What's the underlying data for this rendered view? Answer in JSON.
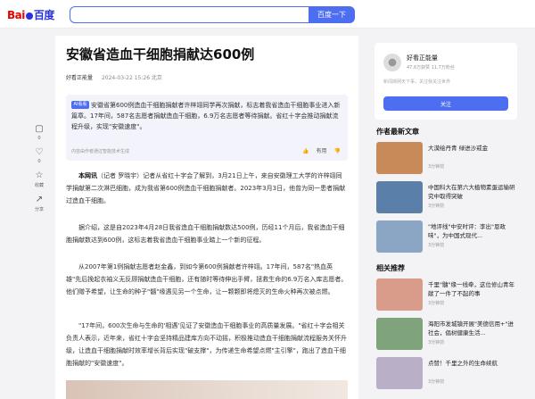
{
  "header": {
    "logo_text_bai": "Bai",
    "logo_text_du": "百度",
    "search_value": "",
    "search_button": "百度一下"
  },
  "article": {
    "title": "安徽省造血干细胞捐献达600例",
    "author": "好看正能量",
    "datetime": "2024-03-22 15:26 北京",
    "ai_tag": "AI看看",
    "ai_summary": "安徽省第600例造血干细胞捐献者许梓翊同学再次捐献，标志着我省造血干细胞事业进入新篇章。17年间，587名志愿者捐献造血干细胞，6.9万名志愿者等待捐献。省红十字会推动捐献流程升级，实现\"安徽速度\"。",
    "ai_footer": "内容由作者通过智能技术生成",
    "ai_useful": "有用",
    "paragraphs": [
      {
        "lead": "本网讯",
        "text": "（记者 罗晓宇）记者从省红十字会了解到，3月21日上午，来自安徽理工大学的许梓翊同学捐献第二次淋巴细胞，成为我省第600例造血干细胞捐献者。2023年3月3日，他曾为同一患者捐献过造血干细胞。"
      },
      {
        "lead": "",
        "text": "据介绍，这是自2023年4月28日我省造血干细胞捐献数达500例，历经11个月后，我省造血干细胞捐献数达到600例，这标志着我省造血干细胞事业踏上一个新的征程。"
      },
      {
        "lead": "",
        "text": "从2007年第1例捐献志愿者赵金鑫，到如今第600例捐献者许梓翊。17年间，587名\"热血英雄\"先后挽起衣袖义无反顾捐献造血干细胞，还有随时等待伸出手臂，拯救生命的6.9万名入库志愿者。他们赠予希望，让生命的种子\"髓\"缘遇见另一个生命，让一颗颗即将熄灭的生命火种再次被点燃。"
      },
      {
        "lead": "",
        "text": "\"17年间，600次生命与生命的'相遇'见证了安徽造血干细胞事业的高质量发展。\"省红十字会相关负责人表示，近年来，省红十字会坚持精品建库方向不动摇，积极推动造血干细胞捐献流程服务关怀升级，让造血干细胞捐献时效率增长背后实现\"破支撑\"，为传递生命希望点燃\"主引擎\"，跑出了造血干细胞捐献的\"安徽速度\"。"
      }
    ]
  },
  "float_actions": [
    {
      "icon": "comment-icon",
      "label": "0"
    },
    {
      "icon": "like-icon",
      "label": "0"
    },
    {
      "icon": "star-icon",
      "label": "收藏"
    },
    {
      "icon": "share-icon",
      "label": "分享"
    }
  ],
  "author_card": {
    "name": "好看正能量",
    "stats": "47.6万获赞 11.7万粉丝",
    "desc": "新闻撷网天下事，关注我关注世界",
    "follow_button": "关注"
  },
  "author_news": {
    "title": "作者最新文章",
    "items": [
      {
        "title": "大漠绘丹青 绿进沙戒金",
        "sub": "3分钟前",
        "color": "#c98a5a"
      },
      {
        "title": "中国科大在第六大植物素蛋运输研究中取得突破",
        "sub": "3分钟前",
        "color": "#5a7fa8"
      },
      {
        "title": "\"地评线\"中安时评：李出\"恩政味\"，为中国式现代...",
        "sub": "3分钟前",
        "color": "#8aa6c4"
      }
    ]
  },
  "related": {
    "title": "相关推荐",
    "items": [
      {
        "title": "千里\"髓\"缘一线牵，这位修山青年献了一件了不起的事",
        "sub": "3分钟前",
        "color": "#d99c8a"
      },
      {
        "title": "海阳市发城镇开展\"美德信用+\"进社会，倡树健康生活...",
        "sub": "3分钟前",
        "color": "#7fa37a"
      },
      {
        "title": "点赞！千里之外的生命续航",
        "sub": "3分钟前",
        "color": "#b9b0c8"
      }
    ]
  }
}
